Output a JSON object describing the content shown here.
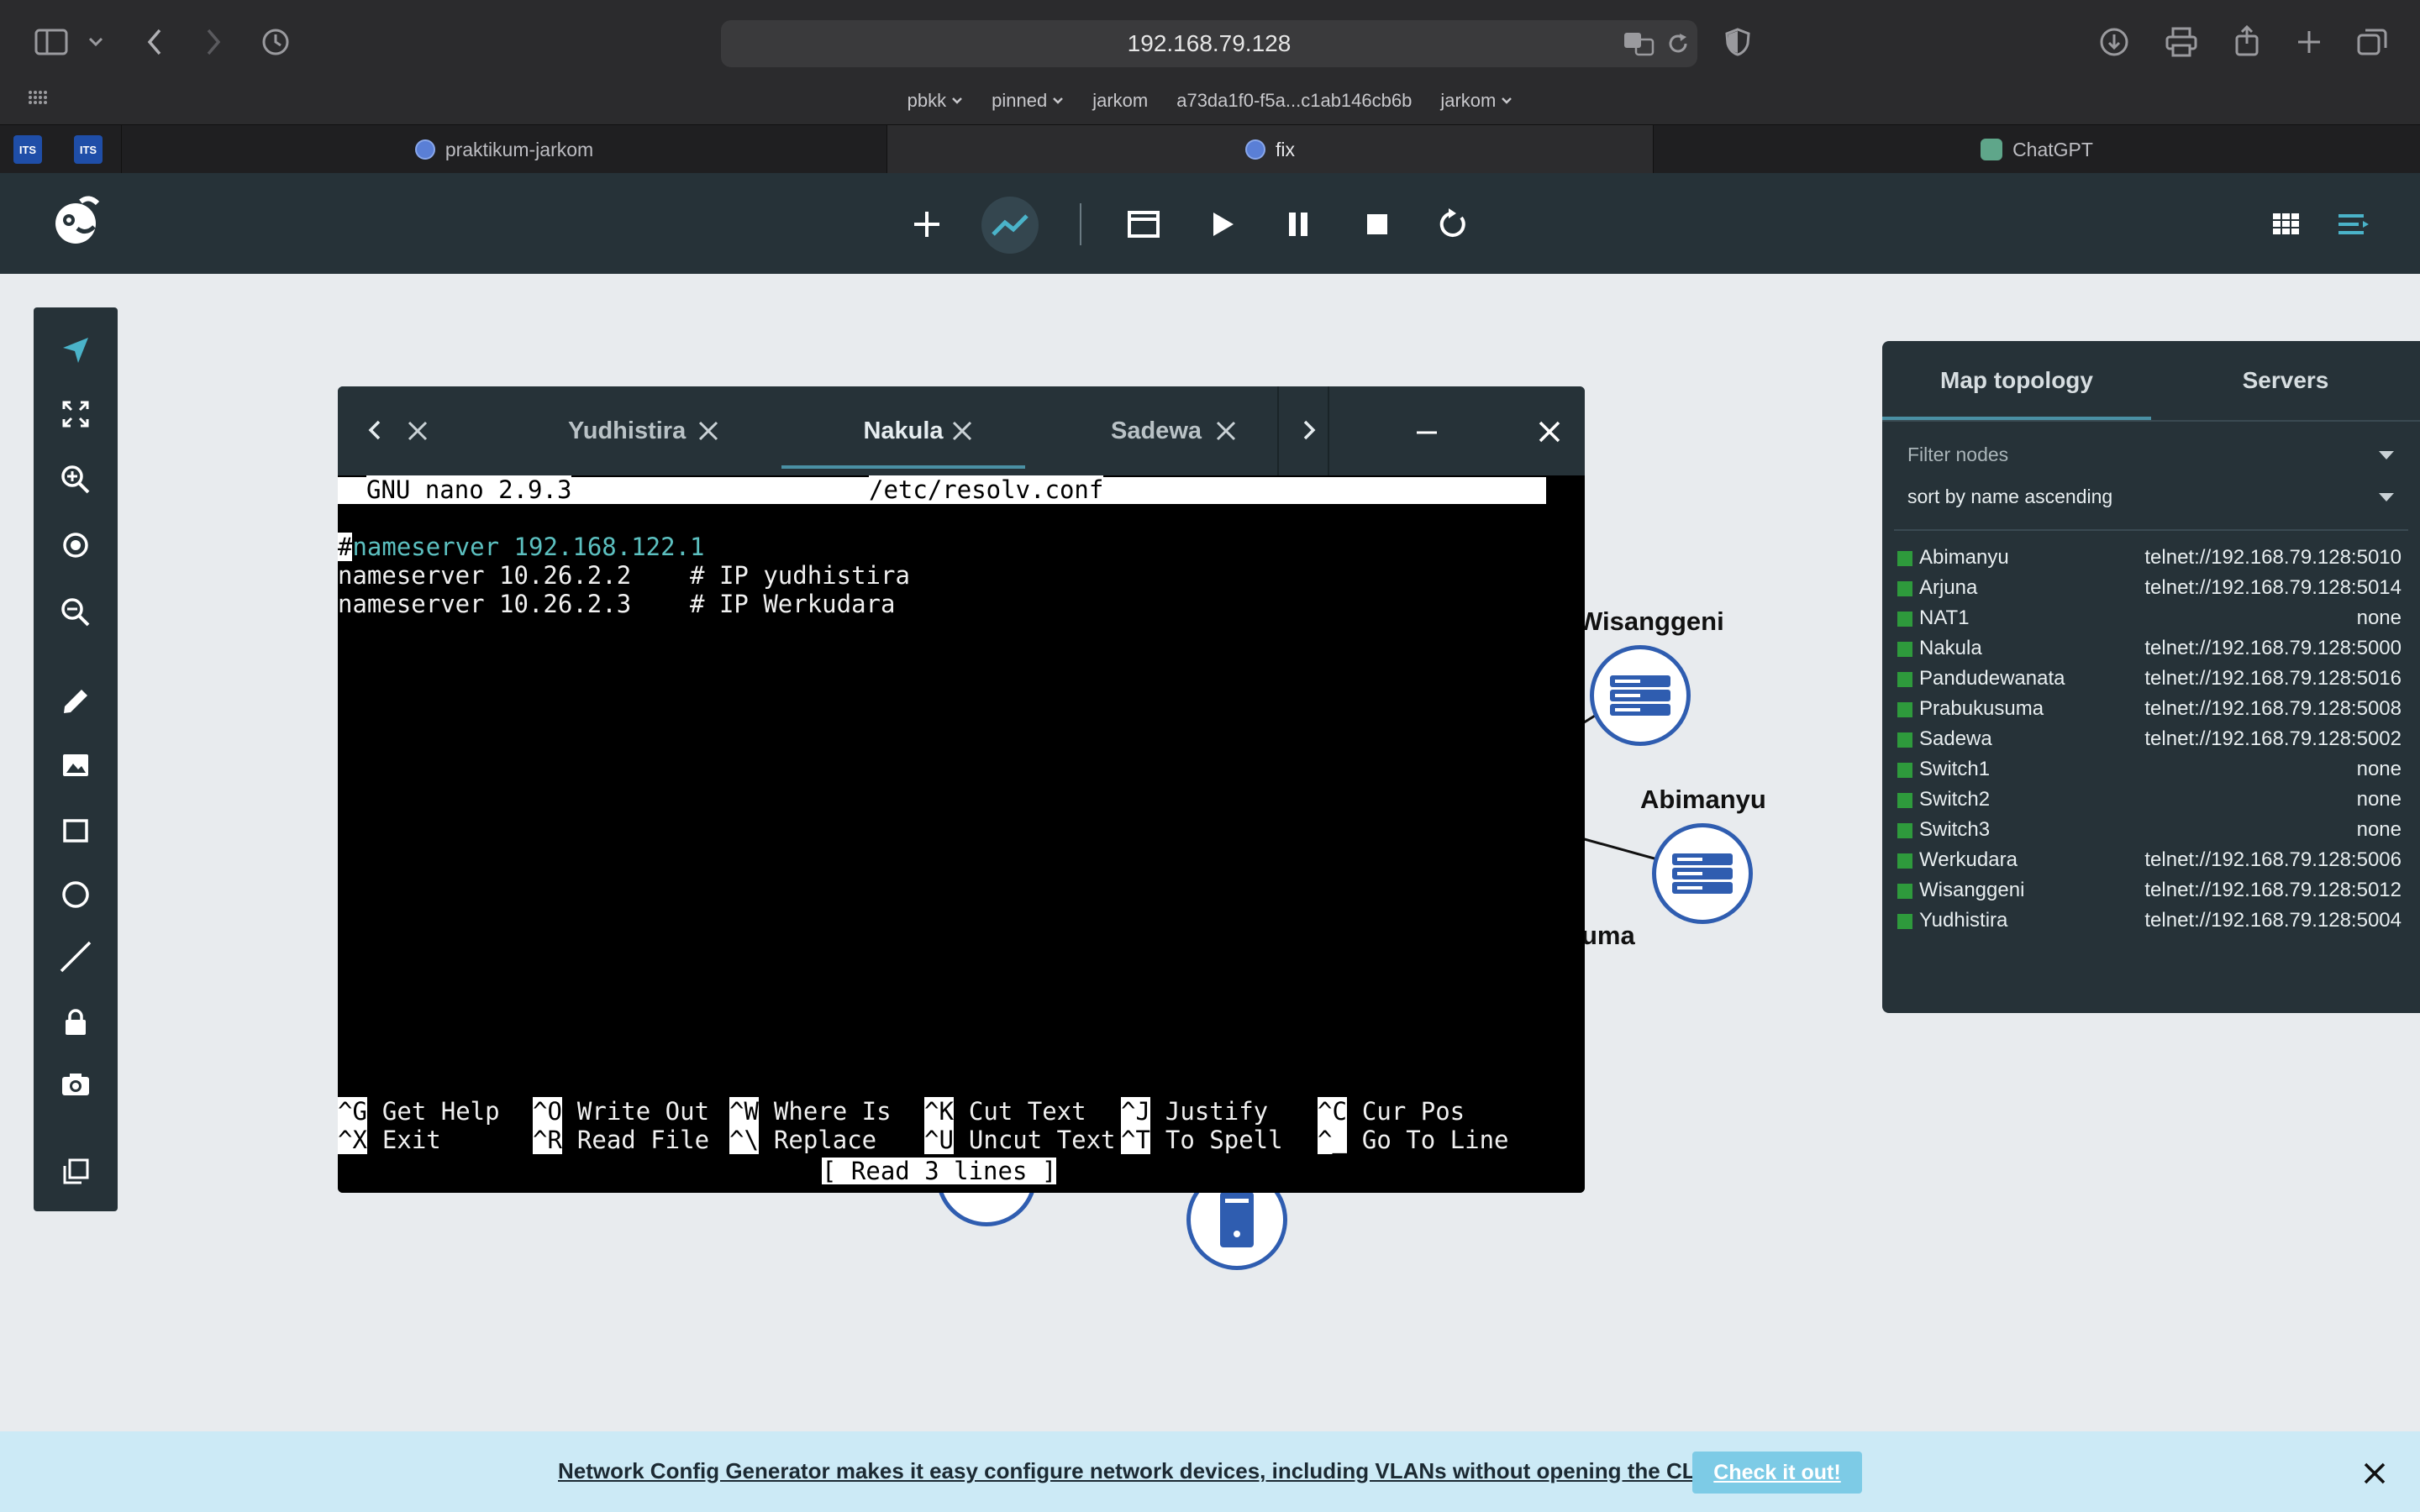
{
  "browser": {
    "url": "192.168.79.128",
    "bookmarks": [
      {
        "label": "pbkk",
        "chevron": true
      },
      {
        "label": "pinned",
        "chevron": true
      },
      {
        "label": "jarkom",
        "chevron": false
      },
      {
        "label": "a73da1f0-f5a...c1ab146cb6b",
        "chevron": false
      },
      {
        "label": "jarkom",
        "chevron": true
      }
    ],
    "pinned_tabs": [
      "ITS",
      "ITS"
    ],
    "tabs": [
      {
        "label": "praktikum-jarkom",
        "active": false
      },
      {
        "label": "fix",
        "active": true
      },
      {
        "label": "ChatGPT",
        "active": false
      }
    ]
  },
  "console": {
    "tabs": [
      {
        "label": "Yudhistira",
        "active": false
      },
      {
        "label": "Nakula",
        "active": true
      },
      {
        "label": "Sadewa",
        "active": false
      }
    ],
    "nano": {
      "header_left": "GNU nano 2.9.3",
      "header_file": "/etc/resolv.conf",
      "line1_cursor": "#",
      "line1_rest": "nameserver 192.168.122.1",
      "line2": "nameserver 10.26.2.2    # IP yudhistira",
      "line3": "nameserver 10.26.2.3    # IP Werkudara",
      "status": "[ Read 3 lines ]",
      "shortcuts": [
        {
          "key": "^G",
          "label": "Get Help"
        },
        {
          "key": "^O",
          "label": "Write Out"
        },
        {
          "key": "^W",
          "label": "Where Is"
        },
        {
          "key": "^K",
          "label": "Cut Text"
        },
        {
          "key": "^J",
          "label": "Justify"
        },
        {
          "key": "^C",
          "label": "Cur Pos"
        },
        {
          "key": "^X",
          "label": "Exit"
        },
        {
          "key": "^R",
          "label": "Read File"
        },
        {
          "key": "^\\",
          "label": "Replace"
        },
        {
          "key": "^U",
          "label": "Uncut Text"
        },
        {
          "key": "^T",
          "label": "To Spell"
        },
        {
          "key": "^_",
          "label": "Go To Line"
        }
      ]
    }
  },
  "canvas": {
    "labels": {
      "wisanggeni": "Wisanggeni",
      "abimanyu": "Abimanyu",
      "partial": "uma"
    }
  },
  "panel": {
    "tabs": [
      "Map topology",
      "Servers"
    ],
    "filter_placeholder": "Filter nodes",
    "sort": "sort by name ascending",
    "nodes": [
      {
        "name": "Abimanyu",
        "console": "telnet://192.168.79.128:5010"
      },
      {
        "name": "Arjuna",
        "console": "telnet://192.168.79.128:5014"
      },
      {
        "name": "NAT1",
        "console": "none"
      },
      {
        "name": "Nakula",
        "console": "telnet://192.168.79.128:5000"
      },
      {
        "name": "Pandudewanata",
        "console": "telnet://192.168.79.128:5016"
      },
      {
        "name": "Prabukusuma",
        "console": "telnet://192.168.79.128:5008"
      },
      {
        "name": "Sadewa",
        "console": "telnet://192.168.79.128:5002"
      },
      {
        "name": "Switch1",
        "console": "none"
      },
      {
        "name": "Switch2",
        "console": "none"
      },
      {
        "name": "Switch3",
        "console": "none"
      },
      {
        "name": "Werkudara",
        "console": "telnet://192.168.79.128:5006"
      },
      {
        "name": "Wisanggeni",
        "console": "telnet://192.168.79.128:5012"
      },
      {
        "name": "Yudhistira",
        "console": "telnet://192.168.79.128:5004"
      }
    ]
  },
  "banner": {
    "text": "Network Config Generator makes it easy configure network devices, including VLANs without opening the CLI",
    "button": "Check it out!"
  },
  "colors": {
    "accent": "#2f5db0",
    "toolbar": "#263238",
    "running": "#2e9a3c",
    "banner": "#cceaf6"
  }
}
